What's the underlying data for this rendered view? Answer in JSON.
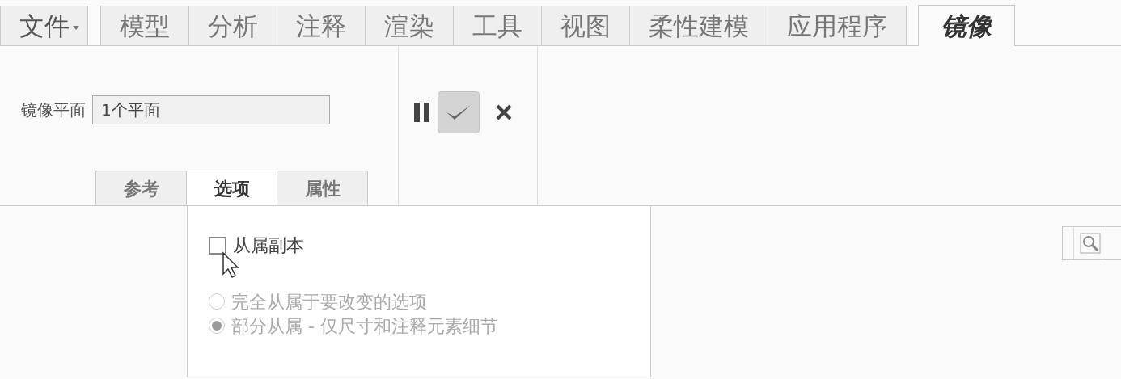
{
  "menu_tabs": [
    {
      "label": "文件",
      "kind": "menu",
      "selected": false
    },
    {
      "label": "模型",
      "kind": "tab",
      "selected": false
    },
    {
      "label": "分析",
      "kind": "tab",
      "selected": false
    },
    {
      "label": "注释",
      "kind": "tab",
      "selected": false
    },
    {
      "label": "渲染",
      "kind": "tab",
      "selected": false
    },
    {
      "label": "工具",
      "kind": "tab",
      "selected": false
    },
    {
      "label": "视图",
      "kind": "tab",
      "selected": false
    },
    {
      "label": "柔性建模",
      "kind": "tab",
      "selected": false
    },
    {
      "label": "应用程序",
      "kind": "tab",
      "selected": false
    },
    {
      "label": "镜像",
      "kind": "tab",
      "selected": true
    }
  ],
  "mirror_plane": {
    "label": "镜像平面",
    "value": "1个平面"
  },
  "actions": [
    {
      "kind": "pause"
    },
    {
      "kind": "confirm"
    },
    {
      "kind": "cancel"
    }
  ],
  "panel_tabs": [
    {
      "label": "参考",
      "selected": false
    },
    {
      "label": "选项",
      "selected": true
    },
    {
      "label": "属性",
      "selected": false
    }
  ],
  "dependent_copy": {
    "label": "从属副本",
    "checked": false
  },
  "dependency_options": [
    {
      "label": "完全从属于要改变的选项",
      "selected": false,
      "disabled": true
    },
    {
      "label": "部分从属 - 仅尺寸和注释元素细节",
      "selected": true,
      "disabled": true
    }
  ]
}
